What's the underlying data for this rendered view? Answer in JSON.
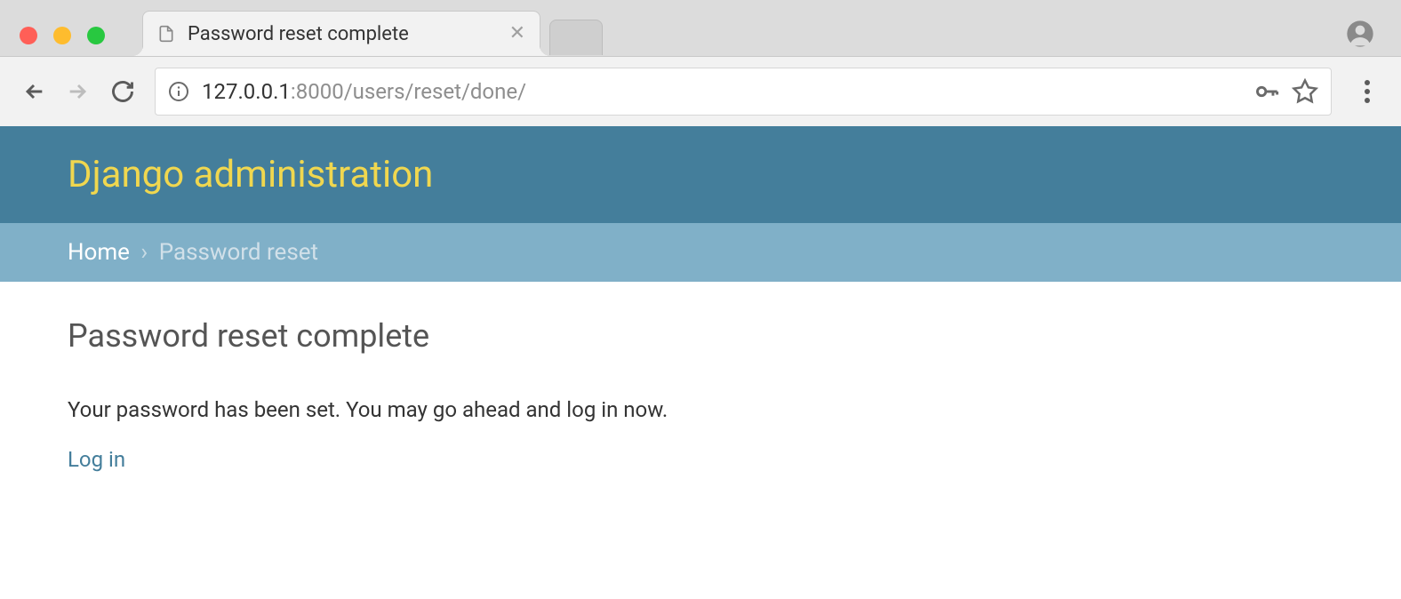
{
  "browser": {
    "tab_title": "Password reset complete",
    "url_host": "127.0.0.1",
    "url_port_path": ":8000/users/reset/done/"
  },
  "header": {
    "title": "Django administration"
  },
  "breadcrumb": {
    "home": "Home",
    "sep": "›",
    "current": "Password reset"
  },
  "main": {
    "heading": "Password reset complete",
    "message": "Your password has been set. You may go ahead and log in now.",
    "login_link": "Log in"
  }
}
